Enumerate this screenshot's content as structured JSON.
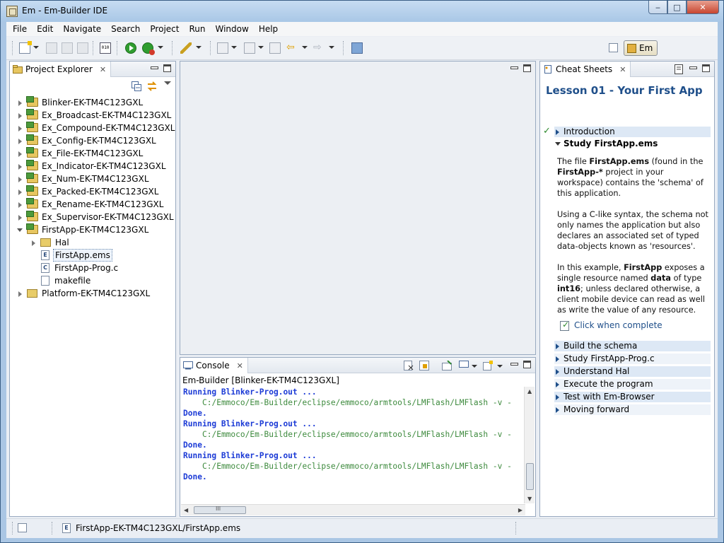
{
  "window": {
    "title": "Em - Em-Builder IDE",
    "min_glyph": "‒",
    "max_glyph": "□",
    "close_glyph": "✕"
  },
  "menu": [
    "File",
    "Edit",
    "Navigate",
    "Search",
    "Project",
    "Run",
    "Window",
    "Help"
  ],
  "toolbar": {
    "perspective_label": "Em"
  },
  "explorer": {
    "tab_label": "Project Explorer",
    "items": [
      {
        "label": "Blinker-EK-TM4C123GXL",
        "kind": "project",
        "expanded": false
      },
      {
        "label": "Ex_Broadcast-EK-TM4C123GXL",
        "kind": "project",
        "expanded": false
      },
      {
        "label": "Ex_Compound-EK-TM4C123GXL",
        "kind": "project",
        "expanded": false
      },
      {
        "label": "Ex_Config-EK-TM4C123GXL",
        "kind": "project",
        "expanded": false
      },
      {
        "label": "Ex_File-EK-TM4C123GXL",
        "kind": "project",
        "expanded": false
      },
      {
        "label": "Ex_Indicator-EK-TM4C123GXL",
        "kind": "project",
        "expanded": false
      },
      {
        "label": "Ex_Num-EK-TM4C123GXL",
        "kind": "project",
        "expanded": false
      },
      {
        "label": "Ex_Packed-EK-TM4C123GXL",
        "kind": "project",
        "expanded": false
      },
      {
        "label": "Ex_Rename-EK-TM4C123GXL",
        "kind": "project",
        "expanded": false
      },
      {
        "label": "Ex_Supervisor-EK-TM4C123GXL",
        "kind": "project",
        "expanded": false
      },
      {
        "label": "FirstApp-EK-TM4C123GXL",
        "kind": "project",
        "expanded": true
      },
      {
        "label": "Hal",
        "kind": "folder",
        "expanded": false
      },
      {
        "label": "FirstApp.ems",
        "kind": "file",
        "selected": true
      },
      {
        "label": "FirstApp-Prog.c",
        "kind": "file"
      },
      {
        "label": "makefile",
        "kind": "file"
      },
      {
        "label": "Platform-EK-TM4C123GXL",
        "kind": "folder-project",
        "expanded": false
      }
    ]
  },
  "console": {
    "tab_label": "Console",
    "subtitle": "Em-Builder [Blinker-EK-TM4C123GXL]",
    "lines": [
      {
        "type": "run",
        "text": "Running Blinker-Prog.out ..."
      },
      {
        "type": "cmd",
        "text": "C:/Emmoco/Em-Builder/eclipse/emmoco/armtools/LMFlash/LMFlash -v -"
      },
      {
        "type": "done",
        "text": "Done."
      },
      {
        "type": "run",
        "text": "Running Blinker-Prog.out ..."
      },
      {
        "type": "cmd",
        "text": "C:/Emmoco/Em-Builder/eclipse/emmoco/armtools/LMFlash/LMFlash -v -"
      },
      {
        "type": "done",
        "text": "Done."
      },
      {
        "type": "run",
        "text": "Running Blinker-Prog.out ..."
      },
      {
        "type": "cmd",
        "text": "C:/Emmoco/Em-Builder/eclipse/emmoco/armtools/LMFlash/LMFlash -v -"
      },
      {
        "type": "done",
        "text": "Done."
      }
    ],
    "hscroll_grip": "III"
  },
  "cheatsheet": {
    "tab_label": "Cheat Sheets",
    "title": "Lesson 01 - Your First App",
    "intro_label": "Introduction",
    "open_step": "Study FirstApp.ems",
    "p1": {
      "a": "The file ",
      "b": "FirstApp.ems",
      "c": " (found in the ",
      "d": "FirstApp-*",
      "e": " project in your workspace) contains the 'schema' of this application."
    },
    "p2": "Using a C-like syntax, the schema not only names the application but also declares an associated set of typed data-objects known as 'resources'.",
    "p3": {
      "a": "In this example, ",
      "b": "FirstApp",
      "c": " exposes a single resource named ",
      "d": "data",
      "e": " of type ",
      "f": "int16",
      "g": "; unless declared otherwise, a client mobile device can read as well as write the value of any resource."
    },
    "complete_link": "Click when complete",
    "steps": [
      "Build the schema",
      "Study FirstApp-Prog.c",
      "Understand Hal",
      "Execute the program",
      "Test with Em-Browser",
      "Moving forward"
    ]
  },
  "statusbar": {
    "path": "FirstApp-EK-TM4C123GXL/FirstApp.ems"
  }
}
